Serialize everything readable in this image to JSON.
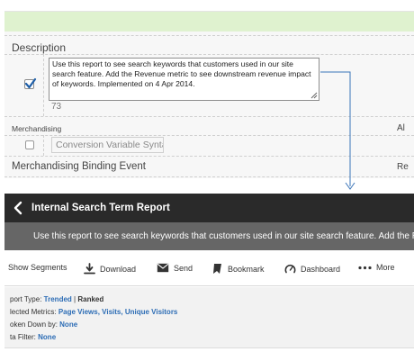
{
  "admin": {
    "description": {
      "label": "Description",
      "checked": true,
      "text": "Use this report to see search keywords that customers used in our site search feature. Add the Revenue metric to see downstream revenue impact of keywords. Implemented on 4 Apr 2014.",
      "char_count": "73"
    },
    "merchandising": {
      "label": "Merchandising",
      "right_cut": "Al",
      "checked": false,
      "value": "Conversion Variable Syntax"
    },
    "binding": {
      "label": "Merchandising Binding Event",
      "right_cut": "Re"
    }
  },
  "report": {
    "title": "Internal Search Term Report",
    "description": "Use this report to see search keywords that customers used in our site search feature. Add the R",
    "toolbar": {
      "show_segments": "Show Segments",
      "download": "Download",
      "send": "Send",
      "bookmark": "Bookmark",
      "dashboard": "Dashboard",
      "more": "More"
    },
    "meta": {
      "type_label": "port Type:",
      "type_trended": "Trended",
      "type_sep": "|",
      "type_ranked": "Ranked",
      "metrics_label": "lected Metrics:",
      "metrics_page_views": "Page Views",
      "metrics_visits": "Visits",
      "metrics_unique": "Unique Visitors",
      "broken_label": "oken Down by:",
      "broken_value": "None",
      "filter_label": "ta Filter:",
      "filter_value": "None"
    }
  },
  "colors": {
    "header_bg": "#2a2a2a",
    "desc_bar_bg": "#666666",
    "link": "#2d6db5",
    "connector": "#3a74b8",
    "success_strip": "#dff2cf"
  }
}
